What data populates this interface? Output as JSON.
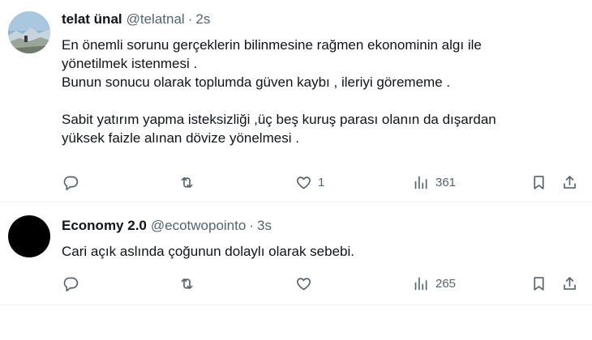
{
  "tweets": [
    {
      "display_name": "telat ünal",
      "handle": "@telatnal",
      "time": "2s",
      "lines": [
        "En önemli sorunu gerçeklerin bilinmesine rağmen ekonominin algı ile",
        "yönetilmek istenmesi .",
        "Bunun sonucu olarak toplumda güven kaybı , ileriyi görememe .",
        "",
        "Sabit yatırım yapma isteksizliği ,üç beş kuruş parası olanın da dışardan",
        "yüksek faizle alınan dövize yönelmesi ."
      ],
      "likes": "1",
      "views": "361"
    },
    {
      "display_name": "Economy 2.0",
      "handle": "@ecotwopointo",
      "time": "3s",
      "lines": [
        "Cari açık aslında çoğunun dolaylı olarak sebebi."
      ],
      "likes": "",
      "views": "265"
    }
  ],
  "icons": {
    "reply": "reply-icon",
    "retweet": "retweet-icon",
    "like": "heart-icon",
    "views": "analytics-icon",
    "bookmark": "bookmark-icon",
    "share": "share-icon"
  },
  "colors": {
    "text": "#0f1419",
    "secondary": "#536471",
    "divider": "#eff3f4"
  }
}
